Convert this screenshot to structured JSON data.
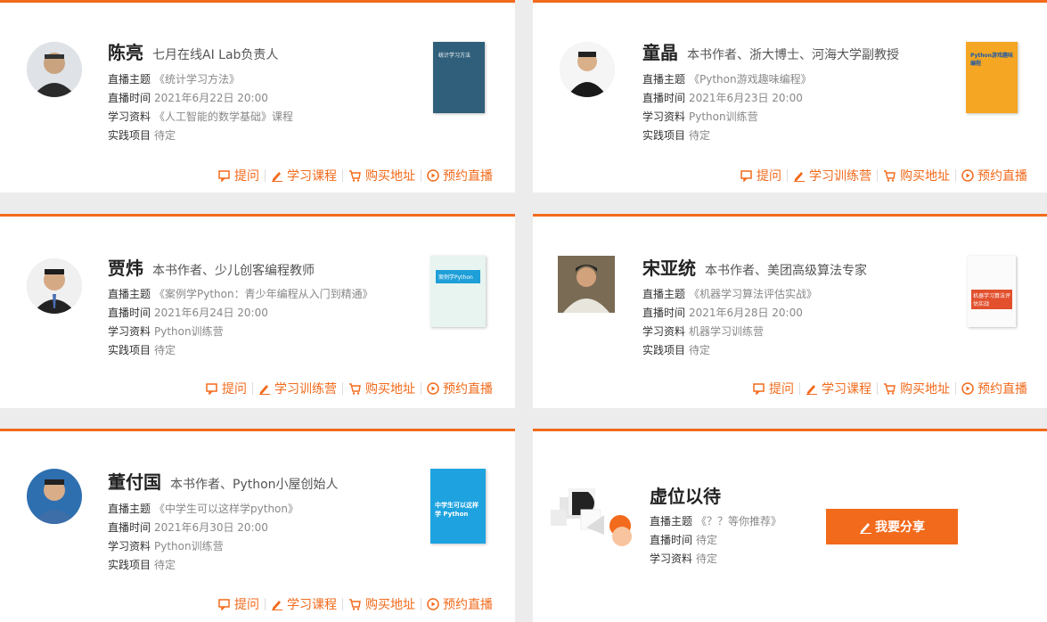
{
  "accent_color": "#f26a1b",
  "labels": {
    "topic": "直播主题",
    "time": "直播时间",
    "material": "学习资料",
    "project": "实践项目"
  },
  "cards": [
    {
      "name": "陈亮",
      "role": "七月在线AI Lab负责人",
      "topic": "《统计学习方法》",
      "time": "2021年6月22日 20:00",
      "material": "《人工智能的数学基础》课程",
      "project": "待定",
      "book_title": "统计学习方法",
      "actions": [
        "提问",
        "学习课程",
        "购买地址",
        "预约直播"
      ]
    },
    {
      "name": "童晶",
      "role": "本书作者、浙大博士、河海大学副教授",
      "topic": "《Python游戏趣味编程》",
      "time": "2021年6月23日 20:00",
      "material": "Python训练营",
      "project": "待定",
      "book_title": "Python游戏趣味编程",
      "actions": [
        "提问",
        "学习训练营",
        "购买地址",
        "预约直播"
      ]
    },
    {
      "name": "贾炜",
      "role": "本书作者、少儿创客编程教师",
      "topic": "《案例学Python：青少年编程从入门到精通》",
      "time": "2021年6月24日 20:00",
      "material": "Python训练营",
      "project": "待定",
      "book_title": "案例学Python",
      "actions": [
        "提问",
        "学习训练营",
        "购买地址",
        "预约直播"
      ]
    },
    {
      "name": "宋亚统",
      "role": "本书作者、美团高级算法专家",
      "topic": "《机器学习算法评估实战》",
      "time": "2021年6月28日 20:00",
      "material": "机器学习训练营",
      "project": "待定",
      "book_title": "机器学习算法评估实战",
      "actions": [
        "提问",
        "学习课程",
        "购买地址",
        "预约直播"
      ]
    },
    {
      "name": "董付国",
      "role": "本书作者、Python小屋创始人",
      "topic": "《中学生可以这样学python》",
      "time": "2021年6月30日 20:00",
      "material": "Python训练营",
      "project": "待定",
      "book_title": "中学生可以这样学 Python",
      "actions": [
        "提问",
        "学习课程",
        "购买地址",
        "预约直播"
      ]
    }
  ],
  "placeholder": {
    "name": "虚位以待",
    "topic": "《？？等你推荐》",
    "time": "待定",
    "material": "待定",
    "button": "我要分享"
  }
}
